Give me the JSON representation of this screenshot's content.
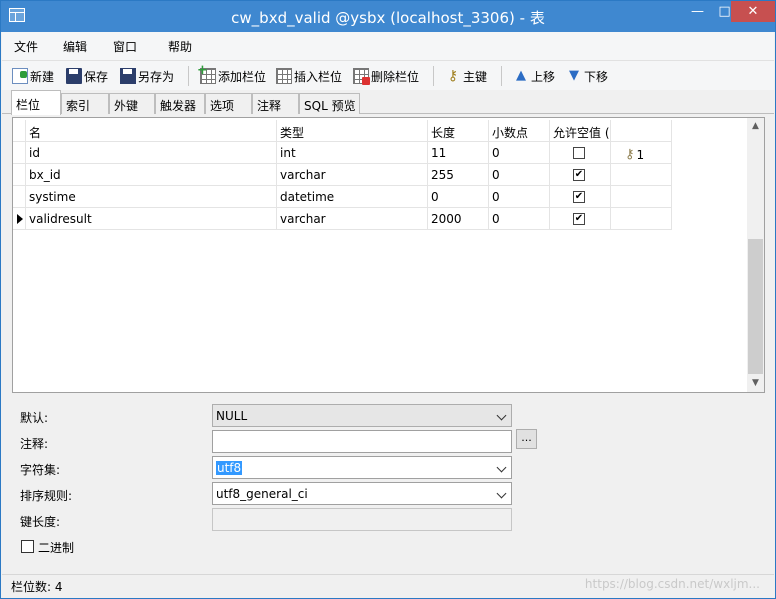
{
  "window": {
    "title": "cw_bxd_valid @ysbx (localhost_3306) - 表",
    "min_glyph": "—",
    "max_glyph": "□",
    "close_glyph": "✕"
  },
  "menu": [
    "文件",
    "编辑",
    "窗口",
    "帮助"
  ],
  "toolbar": {
    "new": "新建",
    "save": "保存",
    "save_as": "另存为",
    "add_field": "添加栏位",
    "insert_field": "插入栏位",
    "delete_field": "删除栏位",
    "primary_key": "主键",
    "move_up": "上移",
    "move_down": "下移",
    "icons": [
      "new-icon",
      "save-icon",
      "save-as-icon",
      "add-field-icon",
      "insert-field-icon",
      "delete-field-icon",
      "key-icon",
      "arrow-up-icon",
      "arrow-down-icon"
    ]
  },
  "tabs": [
    "栏位",
    "索引",
    "外键",
    "触发器",
    "选项",
    "注释",
    "SQL 预览"
  ],
  "grid": {
    "headers": [
      "名",
      "类型",
      "长度",
      "小数点",
      "允许空值 (",
      ""
    ],
    "rows": [
      {
        "name": "id",
        "type": "int",
        "length": "11",
        "decimals": "0",
        "nullable": false,
        "key": "1"
      },
      {
        "name": "bx_id",
        "type": "varchar",
        "length": "255",
        "decimals": "0",
        "nullable": true,
        "key": ""
      },
      {
        "name": "systime",
        "type": "datetime",
        "length": "0",
        "decimals": "0",
        "nullable": true,
        "key": ""
      },
      {
        "name": "validresult",
        "type": "varchar",
        "length": "2000",
        "decimals": "0",
        "nullable": true,
        "key": ""
      }
    ],
    "current_row": 3,
    "check_glyph": "✔",
    "key_glyph": "⚷",
    "cursor_glyph": "▶"
  },
  "properties": {
    "default_label": "默认:",
    "default_value": "NULL",
    "comment_label": "注释:",
    "comment_value": "",
    "ellipsis": "...",
    "charset_label": "字符集:",
    "charset_value": "utf8",
    "collation_label": "排序规则:",
    "collation_value": "utf8_general_ci",
    "key_length_label": "键长度:",
    "key_length_value": "",
    "binary_label": "二进制",
    "binary_checked": false
  },
  "status": {
    "text": "栏位数: 4",
    "watermark": "https://blog.csdn.net/wxljm..."
  }
}
